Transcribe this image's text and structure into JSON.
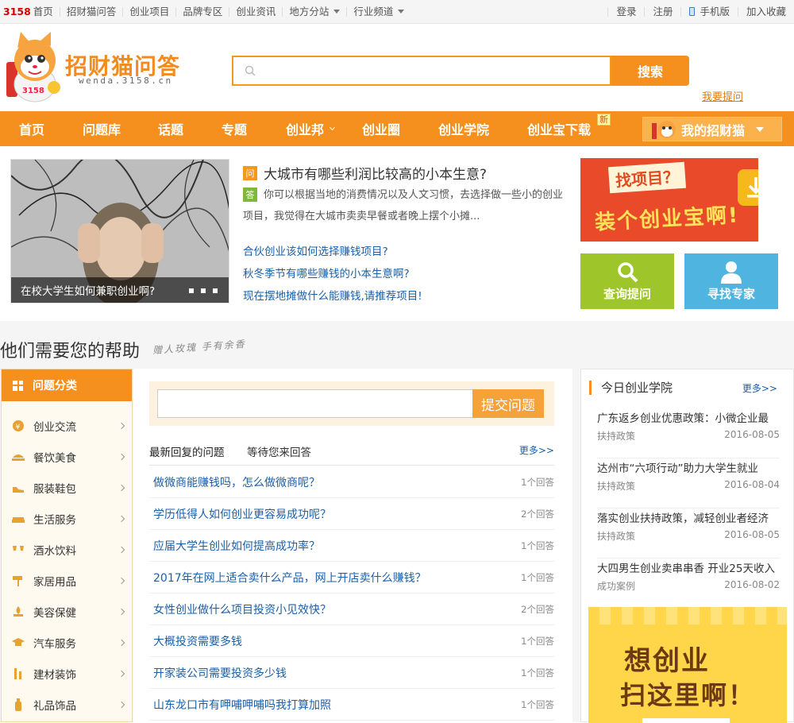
{
  "topbar": {
    "home_prefix": "3158",
    "home_label": "首页",
    "links": [
      "招财猫问答",
      "创业项目",
      "品牌专区",
      "创业资讯",
      "地方分站",
      "行业频道"
    ],
    "right": [
      "登录",
      "注册",
      "手机版",
      "加入收藏"
    ]
  },
  "header": {
    "logo_title": "招财猫问答",
    "logo_sub": "wenda.3158.cn",
    "search_placeholder": "",
    "search_btn": "搜索",
    "ask_link": "我要提问"
  },
  "nav": {
    "items": [
      "首页",
      "问题库",
      "话题",
      "专题",
      "创业邦",
      "创业圈",
      "创业学院",
      "创业宝下载"
    ],
    "new_badge": "新",
    "my_cat": "我的招财猫"
  },
  "featured": {
    "hero_caption": "在校大学生如何兼职创业啊?",
    "q_mark": "问",
    "a_mark": "答",
    "question": "大城市有哪些利润比较高的小本生意?",
    "answer": "你可以根据当地的消费情况以及人文习惯，去选择做一些小的创业项目，我觉得在大城市卖卖早餐或者晚上摆个小摊...",
    "links": [
      "合伙创业该如何选择赚钱项目?",
      "秋冬季节有哪些赚钱的小本生意啊?",
      "现在摆地摊做什么能赚钱,请推荐项目!"
    ],
    "ad_line1": "找项目？",
    "ad_line2": "装个创业宝啊!",
    "btn_query": "查询提问",
    "btn_expert": "寻找专家"
  },
  "help": {
    "title": "他们需要您的帮助",
    "slogan": "赠人玫瑰 手有余香"
  },
  "categories": {
    "head": "问题分类",
    "items": [
      {
        "label": "创业交流",
        "icon": "coin-icon"
      },
      {
        "label": "餐饮美食",
        "icon": "food-icon"
      },
      {
        "label": "服装鞋包",
        "icon": "shoe-icon"
      },
      {
        "label": "生活服务",
        "icon": "sofa-icon"
      },
      {
        "label": "酒水饮料",
        "icon": "glasses-icon"
      },
      {
        "label": "家居用品",
        "icon": "paint-roller-icon"
      },
      {
        "label": "美容保健",
        "icon": "spa-icon"
      },
      {
        "label": "汽车服务",
        "icon": "graduation-cap-icon"
      },
      {
        "label": "建材装饰",
        "icon": "brush-icon"
      },
      {
        "label": "礼品饰品",
        "icon": "bottle-icon"
      }
    ]
  },
  "questions": {
    "submit_btn": "提交问题",
    "tab_latest": "最新回复的问题",
    "tab_waiting": "等待您来回答",
    "more": "更多>>",
    "rows": [
      {
        "title": "做微商能赚钱吗，怎么做微商呢？",
        "count": "1个回答"
      },
      {
        "title": "学历低得人如何创业更容易成功呢？",
        "count": "2个回答"
      },
      {
        "title": "应届大学生创业如何提高成功率？",
        "count": "1个回答"
      },
      {
        "title": "2017年在网上适合卖什么产品，网上开店卖什么赚钱？",
        "count": "1个回答"
      },
      {
        "title": "女性创业做什么项目投资小见效快？",
        "count": "2个回答"
      },
      {
        "title": "大概投资需要多钱",
        "count": "1个回答"
      },
      {
        "title": "开家装公司需要投资多少钱",
        "count": "1个回答"
      },
      {
        "title": "山东龙口市有呷哺呷哺吗我打算加照",
        "count": "1个回答"
      }
    ]
  },
  "academy": {
    "head": "今日创业学院",
    "more": "更多>>",
    "news": [
      {
        "title": "广东返乡创业优惠政策：小微企业最",
        "cat": "扶持政策",
        "date": "2016-08-05"
      },
      {
        "title": "达州市“六项行动”助力大学生就业",
        "cat": "扶持政策",
        "date": "2016-08-04"
      },
      {
        "title": "落实创业扶持政策，减轻创业者经济",
        "cat": "扶持政策",
        "date": "2016-08-05"
      },
      {
        "title": "大四男生创业卖串串香 开业25天收入",
        "cat": "成功案例",
        "date": "2016-08-02"
      }
    ],
    "ad_line1": "想创业",
    "ad_line2": "扫这里啊！"
  }
}
